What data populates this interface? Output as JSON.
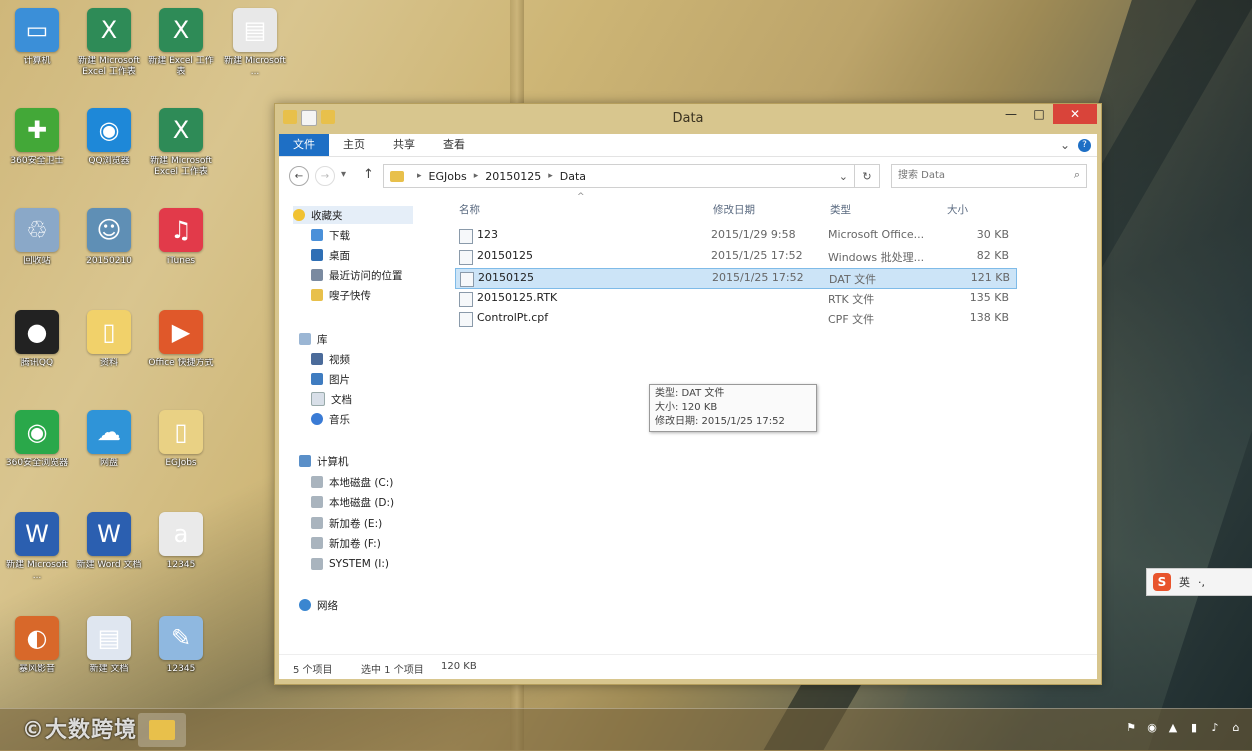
{
  "desktop": {
    "icons": [
      {
        "label": "计算机",
        "icon": "computer-icon",
        "color": "#3b8fd8"
      },
      {
        "label": "新建 Microsoft Excel 工作表",
        "icon": "excel-icon",
        "color": "#2e8b57"
      },
      {
        "label": "新建 Excel 工作表",
        "icon": "excel-icon",
        "color": "#2e8b57"
      },
      {
        "label": "新建 Microsoft ...",
        "icon": "document-icon",
        "color": "#e8e8e8"
      },
      {
        "label": "360安全卫士",
        "icon": "security-icon",
        "color": "#43a838"
      },
      {
        "label": "QQ浏览器",
        "icon": "browser-icon",
        "color": "#1e88d8"
      },
      {
        "label": "新建 Microsoft Excel 工作表",
        "icon": "excel-icon",
        "color": "#2e8b57"
      },
      {
        "label": "回收站",
        "icon": "recycle-bin-icon",
        "color": "#8aa8c8"
      },
      {
        "label": "20150210",
        "icon": "photo-icon",
        "color": "#5f8fb5"
      },
      {
        "label": "iTunes",
        "icon": "music-icon",
        "color": "#e23a4a"
      },
      {
        "label": "腾讯QQ",
        "icon": "qq-icon",
        "color": "#222222"
      },
      {
        "label": "资料",
        "icon": "folder-icon",
        "color": "#f1d16a"
      },
      {
        "label": "Office 快捷方式",
        "icon": "app-icon",
        "color": "#e0582a"
      },
      {
        "label": "360安全浏览器",
        "icon": "browser-icon",
        "color": "#2aa84a"
      },
      {
        "label": "网盘",
        "icon": "cloud-icon",
        "color": "#2f94d8"
      },
      {
        "label": "EGJobs",
        "icon": "folder-icon",
        "color": "#e9d184"
      },
      {
        "label": "新建 Microsoft ...",
        "icon": "word-icon",
        "color": "#2b5fb0"
      },
      {
        "label": "新建 Word 文档",
        "icon": "word-icon",
        "color": "#2b5fb0"
      },
      {
        "label": "12345",
        "icon": "text-file-icon",
        "color": "#eaeaea"
      },
      {
        "label": "暴风影音",
        "icon": "media-player-icon",
        "color": "#d8682a"
      },
      {
        "label": "新建 文档",
        "icon": "document-icon",
        "color": "#dfe6f0"
      },
      {
        "label": "12345",
        "icon": "notepad-icon",
        "color": "#8fb8e0"
      }
    ]
  },
  "window": {
    "title": "Data",
    "minimize": "—",
    "maximize": "□",
    "close": "✕",
    "ribbon_tabs": [
      "文件",
      "主页",
      "共享",
      "查看"
    ],
    "back": "←",
    "forward": "→",
    "recent": "▾",
    "up": "↑",
    "breadcrumb": [
      "EGJobs",
      "20150125",
      "Data"
    ],
    "addr_dropdown": "⌄",
    "refresh": "↻",
    "search_placeholder": "搜索 Data",
    "search_glyph": "⌕",
    "ribbon_expand": "⌄",
    "help_glyph": "?",
    "nav": {
      "favorites": "收藏夹",
      "favorite_items": [
        "下载",
        "桌面",
        "最近访问的位置",
        "嗖子快传"
      ],
      "library": "库",
      "library_items": [
        "视频",
        "图片",
        "文档",
        "音乐"
      ],
      "computer": "计算机",
      "drives": [
        "本地磁盘 (C:)",
        "本地磁盘 (D:)",
        "新加卷 (E:)",
        "新加卷 (F:)",
        "SYSTEM (I:)"
      ],
      "network": "网络"
    },
    "columns": {
      "name": "名称",
      "date": "修改日期",
      "type": "类型",
      "size": "大小"
    },
    "sort_glyph": "^",
    "files": [
      {
        "name": "123",
        "date": "2015/1/29 9:58",
        "type": "Microsoft Office...",
        "size": "30 KB",
        "selected": false
      },
      {
        "name": "20150125",
        "date": "2015/1/25 17:52",
        "type": "Windows 批处理...",
        "size": "82 KB",
        "selected": false
      },
      {
        "name": "20150125",
        "date": "2015/1/25 17:52",
        "type": "DAT 文件",
        "size": "121 KB",
        "selected": true
      },
      {
        "name": "20150125.RTK",
        "date": "",
        "type": "RTK 文件",
        "size": "135 KB",
        "selected": false
      },
      {
        "name": "ControlPt.cpf",
        "date": "",
        "type": "CPF 文件",
        "size": "138 KB",
        "selected": false
      }
    ],
    "tooltip": {
      "type": "类型: DAT 文件",
      "size": "大小: 120 KB",
      "modified": "修改日期: 2015/1/25 17:52"
    },
    "status": {
      "count": "5 个项目",
      "selected": "选中 1 个项目",
      "size": "120 KB"
    }
  },
  "ime": {
    "logo": "S",
    "lang": "英",
    "mode": "·,"
  },
  "taskbar": {
    "tray_glyphs": [
      "⚑",
      "◉",
      "▲",
      "▮",
      "♪",
      "⌂"
    ],
    "watermark": "©大数跨境"
  },
  "colors": {
    "accent": "#1e6fc5",
    "close": "#d9443a",
    "selection": "#cce4f7"
  }
}
